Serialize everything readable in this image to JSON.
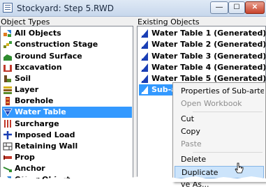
{
  "window": {
    "title": "Stockyard: Step 5.RWD",
    "minimize_glyph": "—",
    "maximize_glyph": "☐",
    "close_glyph": "✕"
  },
  "object_types": {
    "header": "Object Types",
    "items": [
      {
        "label": "All Objects",
        "icon": "all-objects-icon"
      },
      {
        "label": "Construction Stage",
        "icon": "construction-stage-icon"
      },
      {
        "label": "Ground Surface",
        "icon": "ground-surface-icon"
      },
      {
        "label": "Excavation",
        "icon": "excavation-icon"
      },
      {
        "label": "Soil",
        "icon": "soil-icon"
      },
      {
        "label": "Layer",
        "icon": "layer-icon"
      },
      {
        "label": "Borehole",
        "icon": "borehole-icon"
      },
      {
        "label": "Water Table",
        "icon": "water-table-icon",
        "selected": true
      },
      {
        "label": "Surcharge",
        "icon": "surcharge-icon"
      },
      {
        "label": "Imposed Load",
        "icon": "imposed-load-icon"
      },
      {
        "label": "Retaining Wall",
        "icon": "retaining-wall-icon"
      },
      {
        "label": "Prop",
        "icon": "prop-icon"
      },
      {
        "label": "Anchor",
        "icon": "anchor-icon"
      },
      {
        "label": "Other Object",
        "icon": "other-object-icon"
      }
    ]
  },
  "existing_objects": {
    "header": "Existing Objects",
    "items": [
      {
        "label": "Water Table 1 (Generated)",
        "icon": "water-table-object-icon"
      },
      {
        "label": "Water Table 2 (Generated)",
        "icon": "water-table-object-icon"
      },
      {
        "label": "Water Table 3 (Generated)",
        "icon": "water-table-object-icon"
      },
      {
        "label": "Water Table 4 (Generated)",
        "icon": "water-table-object-icon"
      },
      {
        "label": "Water Table 5 (Generated)",
        "icon": "water-table-object-icon"
      },
      {
        "label": "Sub-artesian water table",
        "icon": "water-table-object-icon",
        "selected": true
      }
    ]
  },
  "context_menu": {
    "items": [
      {
        "label": "Properties of  Sub-artesian",
        "disabled": false
      },
      {
        "label": "Open Workbook",
        "disabled": true
      },
      {
        "label": "Cut",
        "disabled": false
      },
      {
        "label": "Copy",
        "disabled": false
      },
      {
        "label": "Paste",
        "disabled": true
      },
      {
        "label": "Delete",
        "disabled": false
      },
      {
        "label": "Duplicate",
        "disabled": false,
        "hover": true
      },
      {
        "label": "ve As...",
        "disabled": false
      }
    ]
  },
  "colors": {
    "selection": "#3399ff",
    "menu_hover": "#cce4fb",
    "water_table_icon": "#1a3fb5"
  }
}
